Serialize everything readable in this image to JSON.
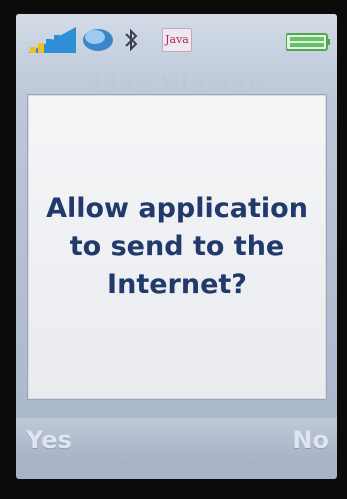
{
  "statusbar": {
    "icons": [
      "signal-icon",
      "network-icon",
      "bluetooth-icon",
      "java-icon",
      "battery-icon"
    ],
    "java_label": "Java"
  },
  "background": {
    "title": "Live Viewer"
  },
  "dialog": {
    "message": "Allow application to send to the Internet?"
  },
  "softkeys": {
    "left": "Yes",
    "right": "No"
  },
  "colors": {
    "message_text": "#22396b",
    "screen_bg": "#bcc7d8",
    "softkey_text": "#dfe5ee"
  }
}
